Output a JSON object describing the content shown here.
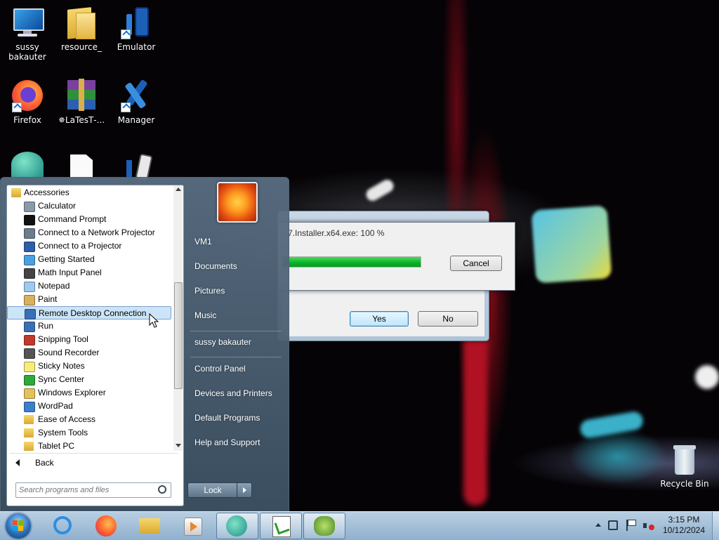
{
  "desktop": {
    "icons": [
      {
        "label": "sussy\nbakauter",
        "icon": "computer-icon"
      },
      {
        "label": "resource_",
        "icon": "folder-icon"
      },
      {
        "label": "Emulator",
        "icon": "phone-tool-icon"
      },
      {
        "label": "Firefox",
        "icon": "firefox-icon"
      },
      {
        "label": "✵LaTesT‐...",
        "icon": "winrar-icon"
      },
      {
        "label": "Manager",
        "icon": "tools-icon"
      }
    ],
    "recycle_bin": "Recycle Bin"
  },
  "install_dialog": {
    "status": "7.Installer.x64.exe: 100 %",
    "progress": 100,
    "cancel": "Cancel"
  },
  "confirm_dialog": {
    "yes": "Yes",
    "no": "No"
  },
  "start_menu": {
    "programs": [
      {
        "label": "Accessories",
        "icon": "folder-icon"
      },
      {
        "label": "Calculator",
        "icon": "calculator-icon"
      },
      {
        "label": "Command Prompt",
        "icon": "command-prompt-icon"
      },
      {
        "label": "Connect to a Network Projector",
        "icon": "network-projector-icon"
      },
      {
        "label": "Connect to a Projector",
        "icon": "projector-icon"
      },
      {
        "label": "Getting Started",
        "icon": "getting-started-icon"
      },
      {
        "label": "Math Input Panel",
        "icon": "math-input-icon"
      },
      {
        "label": "Notepad",
        "icon": "notepad-icon"
      },
      {
        "label": "Paint",
        "icon": "paint-icon"
      },
      {
        "label": "Remote Desktop Connection",
        "icon": "remote-desktop-icon"
      },
      {
        "label": "Run",
        "icon": "run-icon"
      },
      {
        "label": "Snipping Tool",
        "icon": "snipping-tool-icon"
      },
      {
        "label": "Sound Recorder",
        "icon": "sound-recorder-icon"
      },
      {
        "label": "Sticky Notes",
        "icon": "sticky-notes-icon"
      },
      {
        "label": "Sync Center",
        "icon": "sync-center-icon"
      },
      {
        "label": "Windows Explorer",
        "icon": "windows-explorer-icon"
      },
      {
        "label": "WordPad",
        "icon": "wordpad-icon"
      },
      {
        "label": "Ease of Access",
        "icon": "folder-icon"
      },
      {
        "label": "System Tools",
        "icon": "folder-icon"
      },
      {
        "label": "Tablet PC",
        "icon": "folder-icon"
      }
    ],
    "selected_index": 9,
    "back": "Back",
    "search_placeholder": "Search programs and files",
    "right_items": [
      "VM1",
      "Documents",
      "Pictures",
      "Music",
      "sussy bakauter",
      "Control Panel",
      "Devices and Printers",
      "Default Programs",
      "Help and Support"
    ],
    "lock": "Lock"
  },
  "taskbar": {
    "apps": [
      "start-orb-icon",
      "internet-explorer-icon",
      "firefox-icon",
      "file-explorer-icon",
      "media-player-icon",
      "emulator-app-icon",
      "notepad-plus-icon",
      "app-icon"
    ],
    "time": "3:15 PM",
    "date": "10/12/2024"
  },
  "colors": {
    "selection": "#cce4f7",
    "progress": "#06b025",
    "taskbar": "#9fbdd8"
  }
}
